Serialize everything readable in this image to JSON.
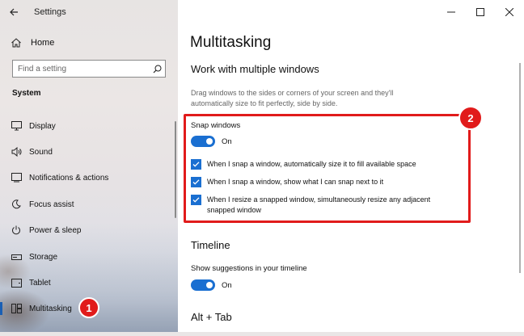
{
  "titlebar": {
    "title": "Settings"
  },
  "sidebar": {
    "home_label": "Home",
    "search_placeholder": "Find a setting",
    "section": "System",
    "items": [
      {
        "label": "Display",
        "icon": "display-icon"
      },
      {
        "label": "Sound",
        "icon": "sound-icon"
      },
      {
        "label": "Notifications & actions",
        "icon": "notifications-icon"
      },
      {
        "label": "Focus assist",
        "icon": "focus-assist-icon"
      },
      {
        "label": "Power & sleep",
        "icon": "power-icon"
      },
      {
        "label": "Storage",
        "icon": "storage-icon"
      },
      {
        "label": "Tablet",
        "icon": "tablet-icon"
      },
      {
        "label": "Multitasking",
        "icon": "multitasking-icon",
        "active": true
      }
    ]
  },
  "main": {
    "page_title": "Multitasking",
    "section1": {
      "heading": "Work with multiple windows",
      "description": "Drag windows to the sides or corners of your screen and they'll automatically size to fit perfectly, side by side.",
      "snap_label": "Snap windows",
      "snap_state": "On",
      "options": [
        "When I snap a window, automatically size it to fill available space",
        "When I snap a window, show what I can snap next to it",
        "When I resize a snapped window, simultaneously resize any adjacent snapped window"
      ]
    },
    "section2": {
      "heading": "Timeline",
      "suggestions_label": "Show suggestions in your timeline",
      "suggestions_state": "On"
    },
    "section3": {
      "heading": "Alt + Tab"
    }
  },
  "annotations": {
    "badge1": "1",
    "badge2": "2"
  },
  "colors": {
    "accent": "#1a6fd1",
    "highlight": "#e11b1b"
  }
}
